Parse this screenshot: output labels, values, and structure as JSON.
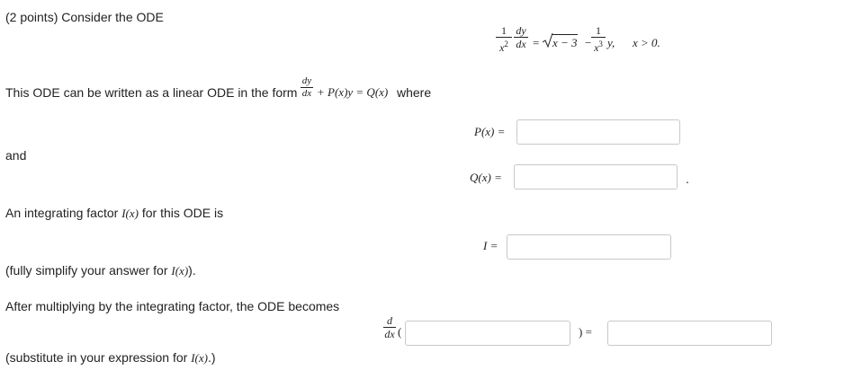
{
  "problem": {
    "header": "(2 points) Consider the ODE",
    "equation": {
      "lhs_num": "1",
      "lhs_den": "x",
      "lhs_den_exp": "2",
      "d_num": "dy",
      "d_den": "dx",
      "eq": "=",
      "sqrt_content": "x − 3",
      "minus": "−",
      "rhs_num": "1",
      "rhs_den": "x",
      "rhs_den_exp": "3",
      "rhs_var": "y,",
      "condition": "x > 0."
    },
    "linear_text": "This ODE can be written as a linear ODE in the form",
    "form_num": "dy",
    "form_den": "dx",
    "form_rest": "+ P(x)y = Q(x)",
    "where_text": "where",
    "p_label": "P(x) =",
    "and_text": "and",
    "q_label": "Q(x) =",
    "q_period": ".",
    "integrating_text_pre": "An integrating factor",
    "integrating_Ix": "I(x)",
    "integrating_text_post": "for this ODE is",
    "i_label": "I =",
    "simplify_pre": "(fully simplify your answer for",
    "simplify_Ix": "I(x)",
    "simplify_post": ").",
    "after_text": "After multiplying by the integrating factor, the ODE becomes",
    "d_num": "d",
    "d_den": "dx",
    "open_paren": "(",
    "close_paren_eq": ")  =",
    "substitute_pre": "(substitute in your expression for",
    "substitute_Ix": "I(x)",
    "substitute_post": ".)"
  },
  "inputs": {
    "p_value": "",
    "q_value": "",
    "i_value": "",
    "d_inner_value": "",
    "rhs_value": ""
  }
}
